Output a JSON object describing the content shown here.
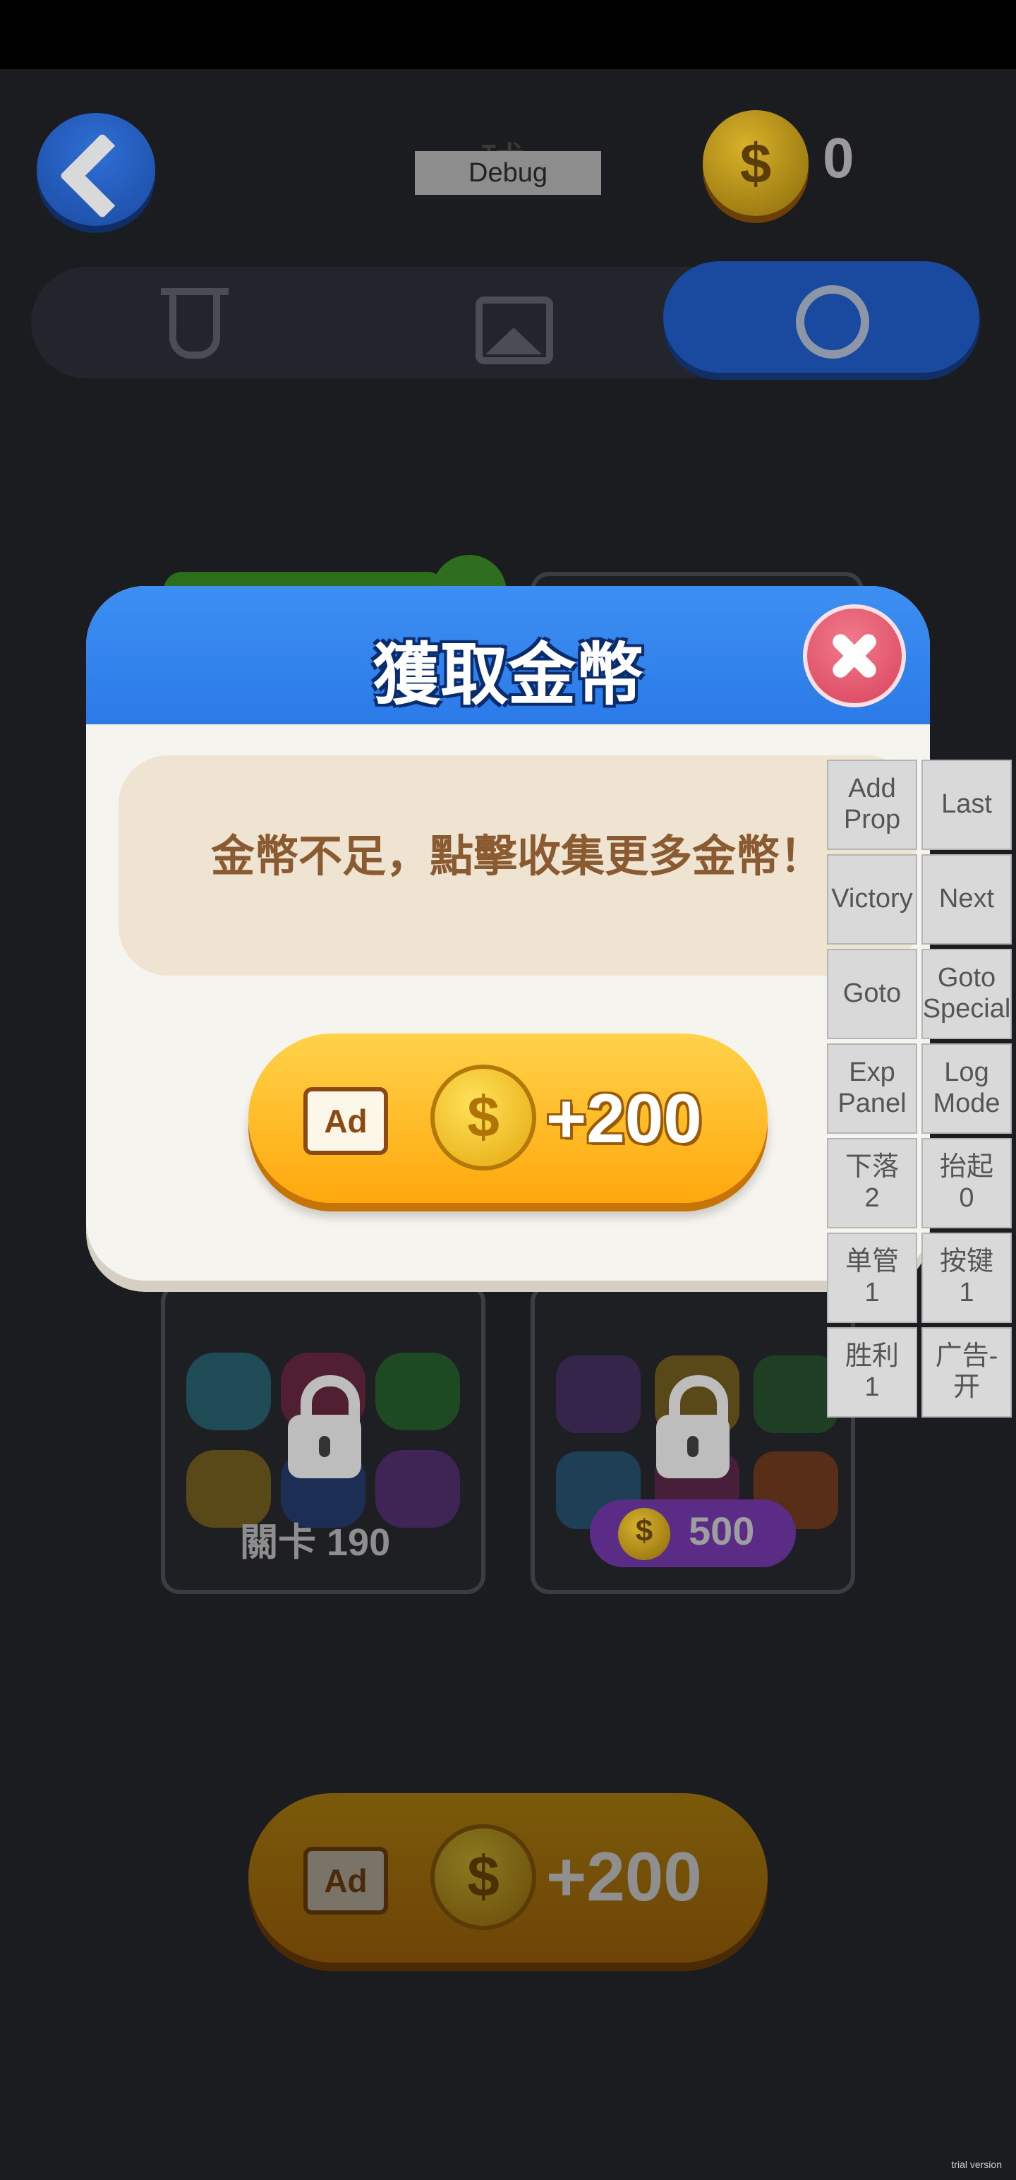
{
  "header": {
    "title": "球",
    "debug_label": "Debug",
    "coins": "0",
    "coin_symbol": "$"
  },
  "tabs": [
    {
      "icon": "test-tube-icon",
      "selected": false
    },
    {
      "icon": "image-icon",
      "selected": false
    },
    {
      "icon": "ball-icon",
      "selected": true
    }
  ],
  "levels": [
    {
      "label": "關卡 190",
      "locked": true
    },
    {
      "price": "500",
      "locked": true
    }
  ],
  "bottom_ad": {
    "badge": "Ad",
    "amount": "+200",
    "coin_symbol": "$"
  },
  "modal": {
    "title": "獲取金幣",
    "message": "金幣不足，點擊收集更多金幣！",
    "ad_button": {
      "badge": "Ad",
      "amount": "+200",
      "coin_symbol": "$"
    }
  },
  "debug_panel": [
    "Add\nProp",
    "Last",
    "Victory",
    "Next",
    "Goto",
    "Goto\nSpecial",
    "Exp\nPanel",
    "Log\nMode",
    "下落\n2",
    "抬起\n0",
    "单管\n1",
    "按键\n1",
    "胜利\n1",
    "广告-开"
  ],
  "watermark": "trial version",
  "colors": {
    "modal_header": "#2b7ae8",
    "coin": "#f5c318",
    "ad_button": "#ffb21e",
    "close": "#e0506a"
  }
}
